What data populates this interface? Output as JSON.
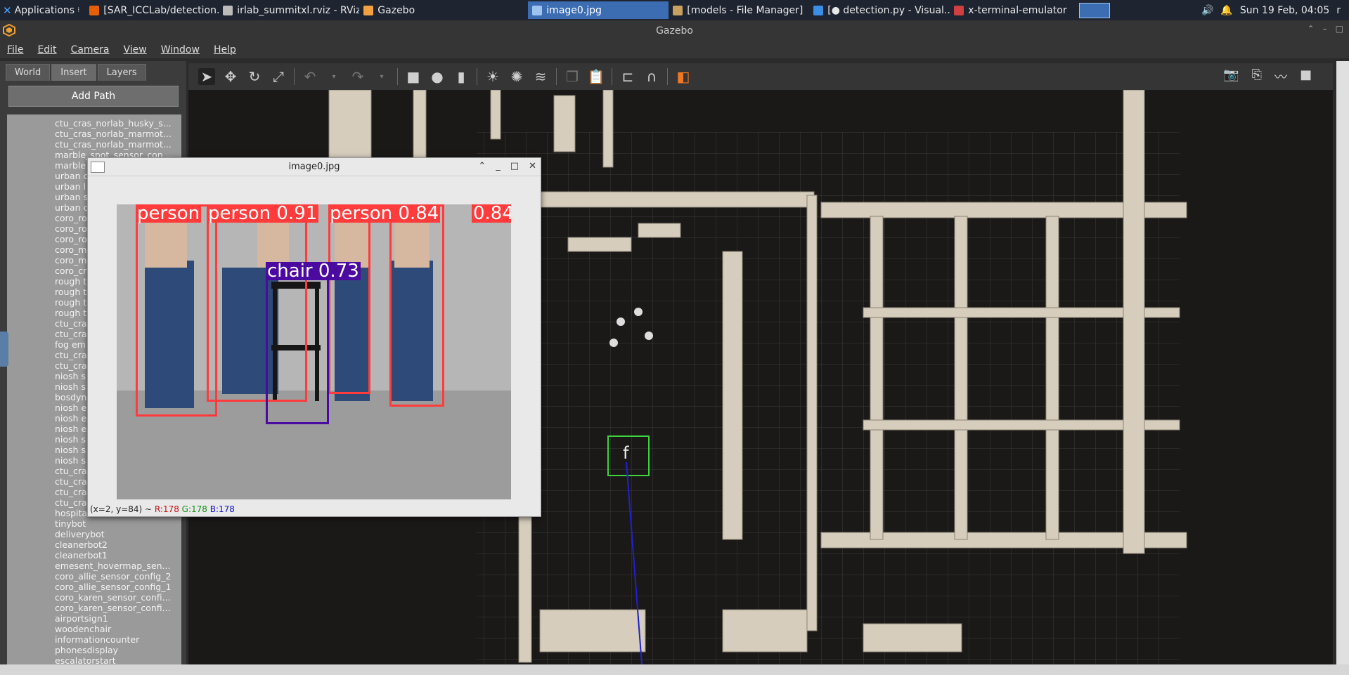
{
  "taskbar": {
    "applications_label": "Applications",
    "tasks": [
      {
        "label": "[SAR_ICCLab/detection....",
        "icon_color": "#e66000",
        "active": false
      },
      {
        "label": "irlab_summitxl.rviz - RViz",
        "icon_color": "#bbbbbb",
        "active": false
      },
      {
        "label": "Gazebo",
        "icon_color": "#f2a040",
        "active": false
      },
      {
        "label": "image0.jpg",
        "icon_color": "#9fc3f0",
        "active": true
      },
      {
        "label": "[models - File Manager]",
        "icon_color": "#c8a060",
        "active": false
      },
      {
        "label": "[● detection.py - Visual...",
        "icon_color": "#3a8ee6",
        "active": false
      },
      {
        "label": "x-terminal-emulator",
        "icon_color": "#d04040",
        "active": false
      }
    ],
    "clock": "Sun 19 Feb, 04:05",
    "trailing": "r"
  },
  "gazebo": {
    "title": "Gazebo",
    "menu": [
      "File",
      "Edit",
      "Camera",
      "View",
      "Window",
      "Help"
    ],
    "tabs": [
      "World",
      "Insert",
      "Layers"
    ],
    "active_tab": "Insert",
    "add_path_label": "Add Path",
    "models": [
      "ctu_cras_norlab_husky_s...",
      "ctu_cras_norlab_marmot...",
      "ctu_cras_norlab_marmot...",
      "marble_spot_sensor_con...",
      "marble",
      "urban c",
      "urban l",
      "urban s",
      "urban c",
      "coro_ro",
      "coro_ro",
      "coro_ro",
      "coro_m",
      "coro_m",
      "coro_cr",
      "rough t",
      "rough t",
      "rough t",
      "rough t",
      "ctu_cra",
      "ctu_cra",
      "fog em",
      "ctu_cra",
      "ctu_cra",
      "niosh s",
      "niosh s",
      "bosdyn",
      "niosh e",
      "niosh e",
      "niosh e",
      "niosh s",
      "niosh s",
      "niosh s",
      "ctu_cra",
      "ctu_cra",
      "ctu_cra",
      "ctu_cra",
      "hospita",
      "tinybot",
      "deliverybot",
      "cleanerbot2",
      "cleanerbot1",
      "emesent_hovermap_sen...",
      "coro_allie_sensor_config_2",
      "coro_allie_sensor_config_1",
      "coro_karen_sensor_confi...",
      "coro_karen_sensor_confi...",
      "airportsign1",
      "woodenchair",
      "informationcounter",
      "phonesdisplay",
      "escalatorstart"
    ]
  },
  "image_window": {
    "title": "image0.jpg",
    "detections": [
      {
        "label": "person",
        "color": "#ff3b3b"
      },
      {
        "label": "person  0.91",
        "color": "#ff3b3b"
      },
      {
        "label": "person  0.84",
        "color": "#ff3b3b"
      },
      {
        "label": "0.84",
        "color": "#ff3b3b"
      },
      {
        "label": "chair  0.73",
        "color": "#4b0aa0"
      }
    ],
    "status": {
      "coords": "(x=2, y=84) ~",
      "r": "R:178",
      "g": "G:178",
      "b": "B:178"
    }
  }
}
